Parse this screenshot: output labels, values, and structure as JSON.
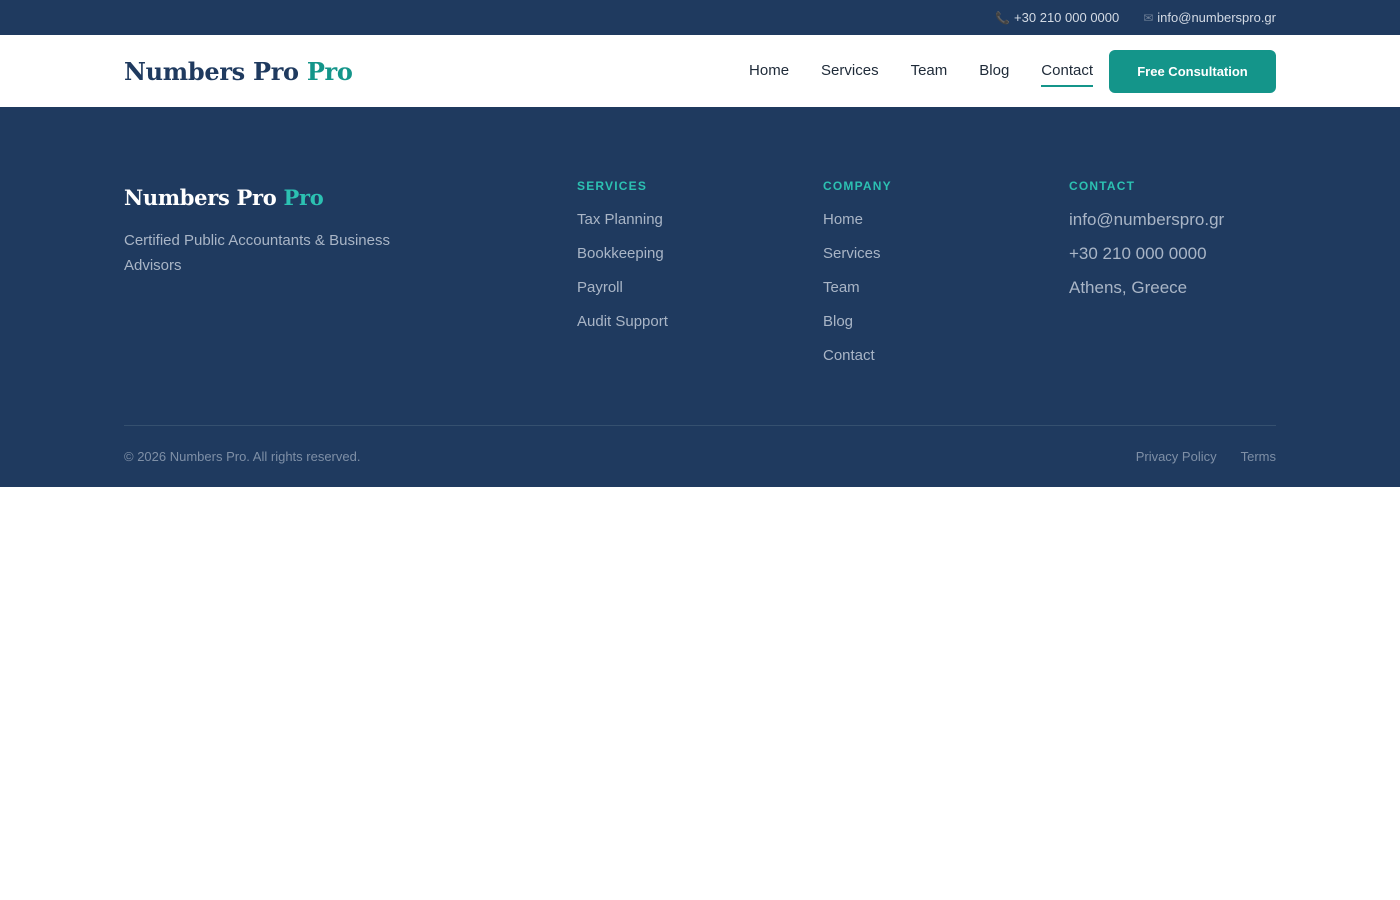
{
  "topbar": {
    "phone_icon": "phone-icon",
    "phone": "+30 210 000 0000",
    "email_icon": "envelope-icon",
    "email": "info@numberspro.gr"
  },
  "header": {
    "logo_main": "Numbers Pro",
    "logo_accent": "Pro",
    "nav": [
      "Home",
      "Services",
      "Team",
      "Blog",
      "Contact"
    ],
    "active_nav": "Contact",
    "cta_label": "Free Consultation"
  },
  "footer": {
    "logo_main": "Numbers Pro",
    "logo_accent": "Pro",
    "tagline": "Certified Public Accountants & Business Advisors",
    "services_heading": "Services",
    "services": [
      "Tax Planning",
      "Bookkeeping",
      "Payroll",
      "Audit Support"
    ],
    "company_heading": "Company",
    "company": [
      "Home",
      "Services",
      "Team",
      "Blog",
      "Contact"
    ],
    "contact_heading": "Contact",
    "contact": [
      "info@numberspro.gr",
      "+30 210 000 0000",
      "Athens, Greece"
    ],
    "copyright": "© 2026 Numbers Pro. All rights reserved.",
    "legal": [
      "Privacy Policy",
      "Terms"
    ]
  },
  "colors": {
    "navy": "#1f3a5f",
    "teal": "#14958a",
    "teal_light": "#2cc1b2",
    "muted_text": "#a9b5c6"
  }
}
